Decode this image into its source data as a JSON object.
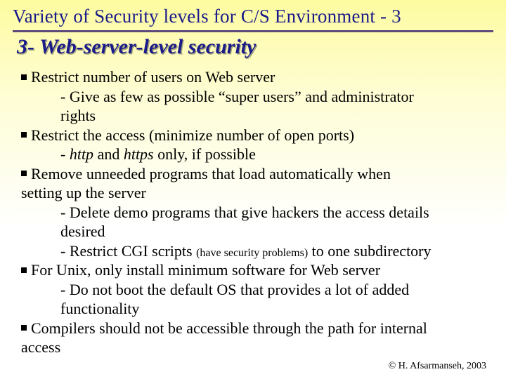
{
  "title": "Variety of Security levels for C/S Environment - 3",
  "subtitle": "3- Web-server-level security",
  "bullets": {
    "b1": "Restrict number of users on Web server",
    "b1s1a": "- Give as few as possible “super users” and administrator",
    "b1s1b": "rights",
    "b2": "Restrict the access (minimize number of open ports)",
    "b2s1a": "- ",
    "b2s1_http": "http",
    "b2s1_mid": " and ",
    "b2s1_https": "https",
    "b2s1_end": " only, if possible",
    "b3a": "Remove unneeded programs that load automatically when",
    "b3b": "setting up the server",
    "b3s1a": "- Delete demo programs that give hackers the access details",
    "b3s1b": "desired",
    "b3s2a": "- Restrict CGI scripts ",
    "b3s2_small": "(have security problems)",
    "b3s2b": " to one subdirectory",
    "b4": "For Unix, only install minimum software for Web server",
    "b4s1a": "- Do not boot the default OS that provides a lot of added",
    "b4s1b": "functionality",
    "b5a": "Compilers should not be accessible through the path for internal",
    "b5b": "access"
  },
  "footer": "© H. Afsarmanseh, 2003"
}
